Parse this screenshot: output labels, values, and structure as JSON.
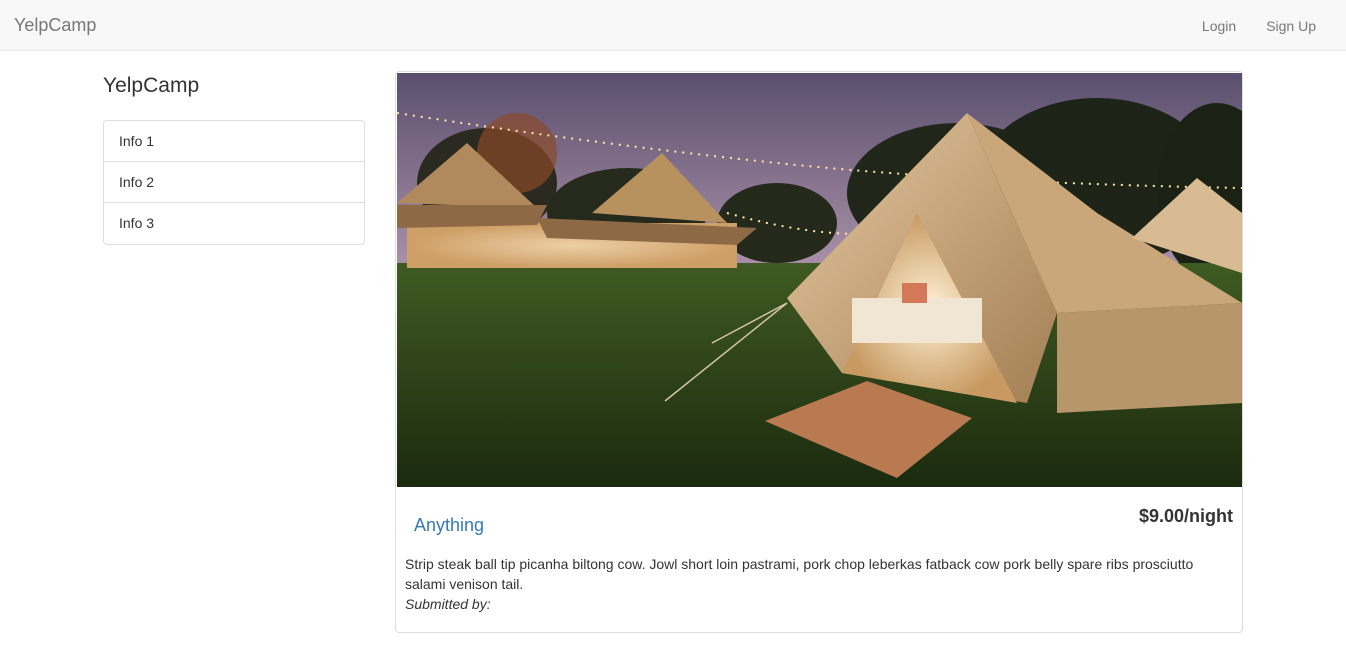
{
  "navbar": {
    "brand": "YelpCamp",
    "links": [
      {
        "label": "Login"
      },
      {
        "label": "Sign Up"
      }
    ]
  },
  "sidebar": {
    "heading": "YelpCamp",
    "items": [
      {
        "label": "Info 1"
      },
      {
        "label": "Info 2"
      },
      {
        "label": "Info 3"
      }
    ]
  },
  "campground": {
    "name": "Anything",
    "price": "$9.00/night",
    "description": "Strip steak ball tip picanha biltong cow. Jowl short loin pastrami, pork chop leberkas fatback cow pork belly spare ribs prosciutto salami venison tail.",
    "submitted_by": "Submitted by:",
    "image_alt": "bell tents at night with string lights"
  },
  "colors": {
    "link": "#337ab7",
    "navbar_bg": "#f8f8f8",
    "text": "#333333",
    "muted": "#777777",
    "border": "#dddddd"
  }
}
